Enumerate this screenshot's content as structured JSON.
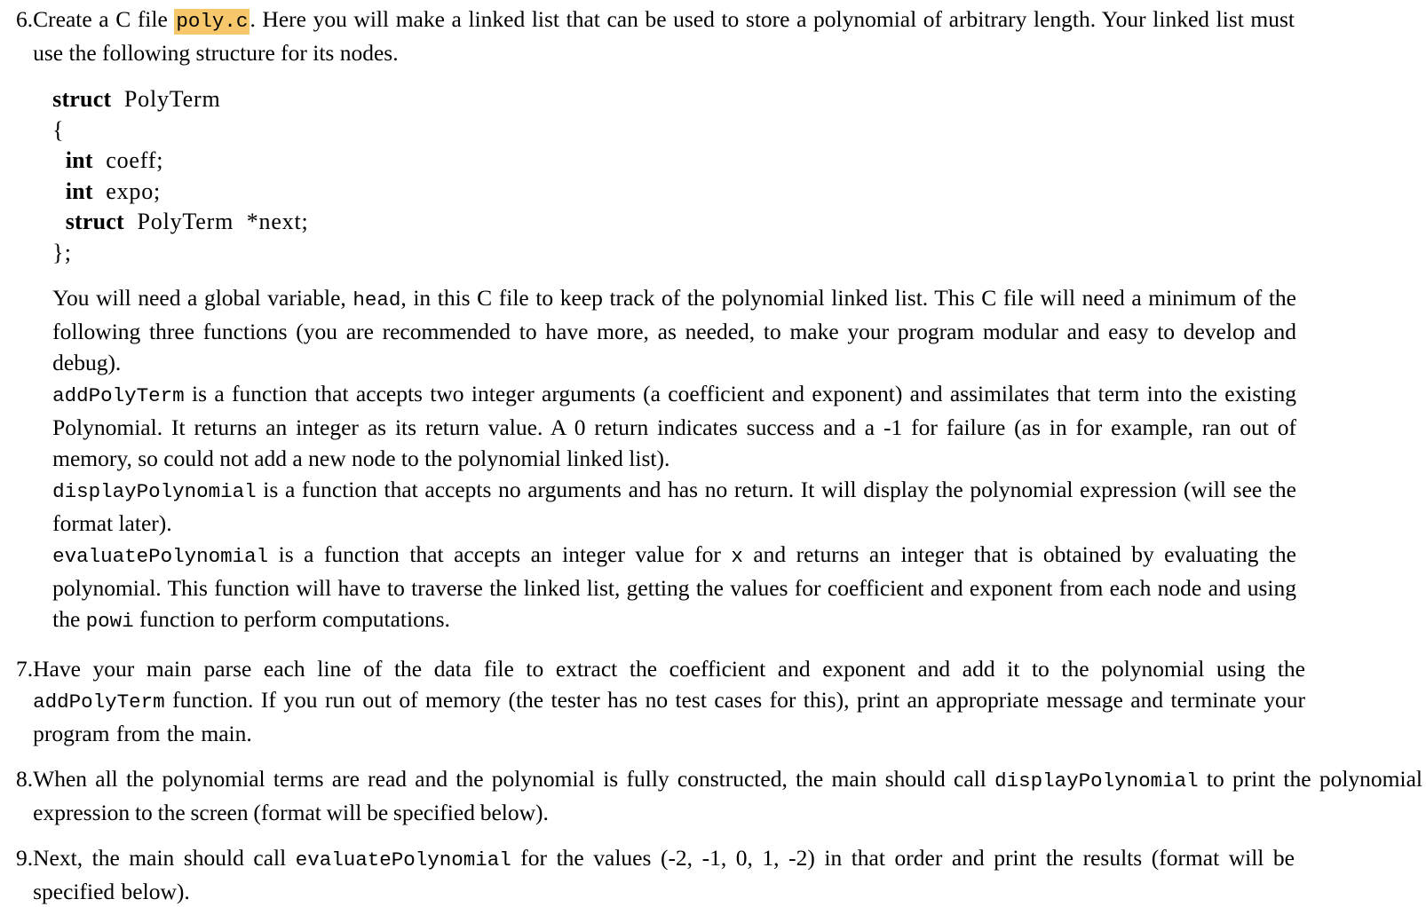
{
  "document": {
    "type": "assignment-instructions",
    "highlight_color": "#f6c86b",
    "text_color": "#000000",
    "background_color": "#ffffff"
  },
  "items": [
    {
      "number": "6.",
      "intro_part1": "Create a C file ",
      "intro_code": "poly.c",
      "intro_part2": ". Here you will make a linked list that can be used to store a polynomial of arbitrary length. Your linked list must use the following structure for its nodes.",
      "listing": {
        "line1_kw": "struct",
        "line1_id": "PolyTerm",
        "line2": "{",
        "line3_kw": "int",
        "line3_id": "coeff",
        "line3_punc": ";",
        "line4_kw": "int",
        "line4_id": "expo",
        "line4_punc": ";",
        "line5_kw": "struct",
        "line5_id": "PolyTerm",
        "line5_ptr": "*next",
        "line5_punc": ";",
        "line6": "};"
      },
      "para_head_1": "You will need a global variable, ",
      "para_head_code": "head",
      "para_head_2": ", in this C file to keep track of the polynomial linked list. This C file will need a minimum of the following three functions (you are recommended to have more, as needed, to make your program modular and easy to develop and debug).",
      "func_add_code": "addPolyTerm",
      "func_add_text": " is a function that accepts two integer arguments (a coefficient and exponent) and assimilates that term into the existing Polynomial. It returns an integer as its return value. A 0 return indicates success and a -1 for failure (as in for example, ran out of memory, so could not add a new node to the polynomial linked list).",
      "func_display_code": "displayPolynomial",
      "func_display_text": " is a function that accepts no arguments and has no return. It will display the polynomial expression (will see the format later).",
      "func_eval_code": "evaluatePolynomial",
      "func_eval_text1": " is a function that accepts an integer value for ",
      "func_eval_x": "x",
      "func_eval_text2": " and returns an integer that is obtained by evaluating the polynomial. This function will have to traverse the linked list, getting the values for coefficient and exponent from each node and using the ",
      "func_eval_powi": "powi",
      "func_eval_text3": " function to perform computations."
    },
    {
      "number": "7.",
      "text1": "Have your main parse each line of the data file to extract the coefficient and exponent and add it to the polynomial using the ",
      "code1": "addPolyTerm",
      "text2": " function. If you run out of memory (the tester has no test cases for this), print an appropriate message and terminate your program from the main."
    },
    {
      "number": "8.",
      "text1": "When all the polynomial terms are read and the polynomial is fully constructed, the main should call ",
      "code1": "displayPolynomial",
      "text2": " to print the polynomial expression to the screen (format will be specified below)."
    },
    {
      "number": "9.",
      "text1": "Next, the main should call ",
      "code1": "evaluatePolynomial",
      "text2": " for the values (-2, -1, 0, 1, -2) in that order and print the results (format will be specified below)."
    }
  ]
}
